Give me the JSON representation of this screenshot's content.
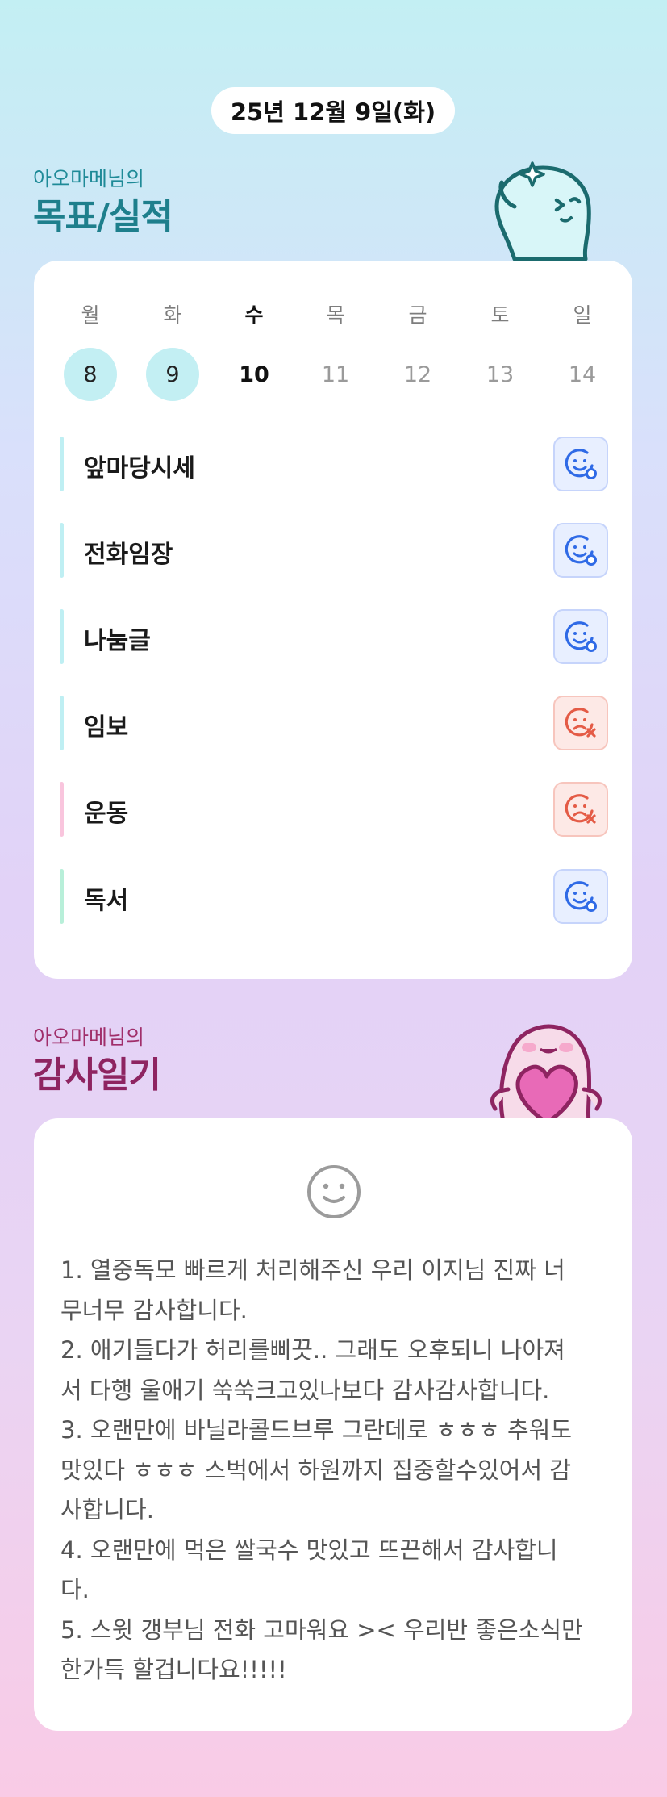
{
  "header": {
    "date": "25년 12월 9일(화)"
  },
  "goals_section": {
    "subtitle": "아오마메님의",
    "title": "목표/실적",
    "subtitle_color": "#1e8a97",
    "title_color": "#1e7f8c"
  },
  "week": {
    "days": [
      {
        "name": "월",
        "num": "8",
        "state": "done"
      },
      {
        "name": "화",
        "num": "9",
        "state": "done"
      },
      {
        "name": "수",
        "num": "10",
        "state": "today"
      },
      {
        "name": "목",
        "num": "11",
        "state": "future"
      },
      {
        "name": "금",
        "num": "12",
        "state": "future"
      },
      {
        "name": "토",
        "num": "13",
        "state": "future"
      },
      {
        "name": "일",
        "num": "14",
        "state": "future"
      }
    ],
    "highlight_color": "#c3eff3"
  },
  "goals": [
    {
      "label": "앞마당시세",
      "status": "success",
      "bar_color": "#bfeff3",
      "status_icon": "smile-check-icon"
    },
    {
      "label": "전화임장",
      "status": "success",
      "bar_color": "#bfeff3",
      "status_icon": "smile-check-icon"
    },
    {
      "label": "나눔글",
      "status": "success",
      "bar_color": "#bfeff3",
      "status_icon": "smile-check-icon"
    },
    {
      "label": "임보",
      "status": "fail",
      "bar_color": "#bfeff3",
      "status_icon": "sad-x-icon"
    },
    {
      "label": "운동",
      "status": "fail",
      "bar_color": "#f9c5dd",
      "status_icon": "sad-x-icon"
    },
    {
      "label": "독서",
      "status": "success",
      "bar_color": "#b8efd9",
      "status_icon": "smile-check-icon"
    }
  ],
  "colors": {
    "success": "#2f6ae6",
    "fail": "#e45b46"
  },
  "gratitude_section": {
    "subtitle": "아오마메님의",
    "title": "감사일기",
    "subtitle_color": "#a02e6a",
    "title_color": "#8e2461",
    "mood_icon": "smile-icon",
    "lines": [
      "1. 열중독모 빠르게 처리해주신 우리 이지님 진짜 너",
      "무너무 감사합니다.",
      "2. 애기들다가 허리를삐끗.. 그래도 오후되니 나아져",
      "서 다행 울애기 쑥쑥크고있나보다 감사감사합니다.",
      "3. 오랜만에 바닐라콜드브루 그란데로 ㅎㅎㅎ 추워도",
      "맛있다 ㅎㅎㅎ 스벅에서 하원까지 집중할수있어서 감",
      "사합니다.",
      "4. 오랜만에 먹은 쌀국수 맛있고 뜨끈해서 감사합니",
      "다.",
      "5. 스윗 갱부님 전화 고마워요 >< 우리반 좋은소식만",
      "한가득 할겁니다요!!!!!"
    ]
  }
}
